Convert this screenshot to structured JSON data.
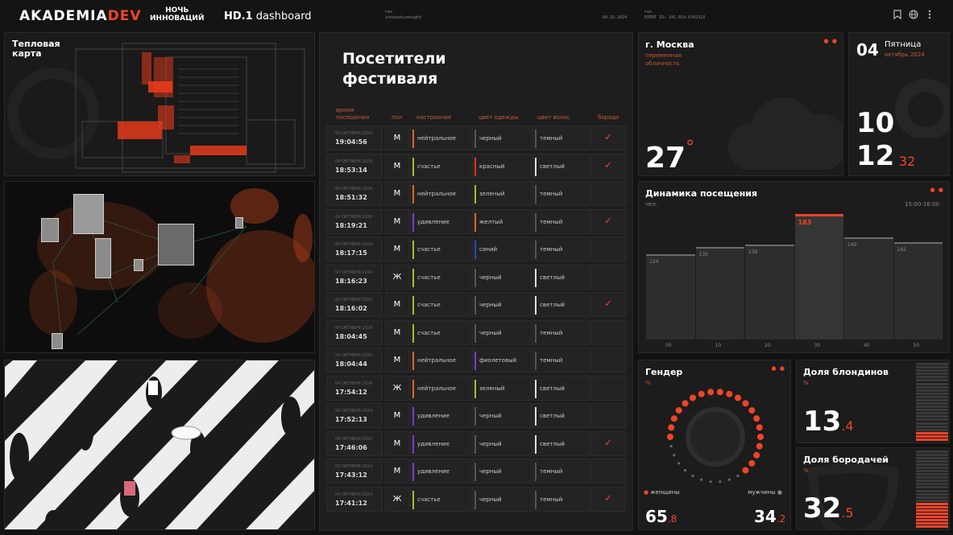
{
  "header": {
    "logo_main": "AKADEMIA",
    "logo_accent": "DEV",
    "partner_line1": "НОЧЬ",
    "partner_line2": "ИННОВАЦИЙ",
    "dashboard_strong": "HD.1",
    "dashboard_rest": " dashboard",
    "meta1_label": "гео",
    "meta1_value": "innovationnight",
    "meta2_value": "04.10.2024",
    "meta3_label": "гео",
    "meta3_value": "EVENT ID: 241.014.6f0231X",
    "icons": [
      "bookmark-icon",
      "globe-icon",
      "more-icon"
    ]
  },
  "heatmap": {
    "title_line1": "Тепловая",
    "title_line2": "карта"
  },
  "visitors": {
    "title_line1": "Посетители",
    "title_line2": "фестиваля",
    "columns": {
      "time": [
        "время",
        "посещения"
      ],
      "gender": "пол",
      "mood": "настроение",
      "clothes": "цвет одежды",
      "hair": "цвет волос",
      "beard": "бородо"
    },
    "rows": [
      {
        "stamp": "04 ОКТЯБРЯ 2024",
        "time": "19:04:56",
        "gender": "М",
        "mood": "нейтральное",
        "mood_color": "#e0662a",
        "clothes": "черный",
        "clothes_color": "#555555",
        "hair": "темный",
        "hair_color": "#555555",
        "beard": true
      },
      {
        "stamp": "04 ОКТЯБРЯ 2024",
        "time": "18:53:14",
        "gender": "М",
        "mood": "счастье",
        "mood_color": "#a8c12a",
        "clothes": "красный",
        "clothes_color": "#e0331e",
        "hair": "светлый",
        "hair_color": "#dddddd",
        "beard": true
      },
      {
        "stamp": "04 ОКТЯБРЯ 2024",
        "time": "18:51:32",
        "gender": "М",
        "mood": "нейтральное",
        "mood_color": "#e0662a",
        "clothes": "зеленый",
        "clothes_color": "#a8c12a",
        "hair": "темный",
        "hair_color": "#555555",
        "beard": false
      },
      {
        "stamp": "04 ОКТЯБРЯ 2024",
        "time": "18:19:21",
        "gender": "М",
        "mood": "удивление",
        "mood_color": "#7a3ad0",
        "clothes": "желтый",
        "clothes_color": "#e0662a",
        "hair": "темный",
        "hair_color": "#555555",
        "beard": true
      },
      {
        "stamp": "04 ОКТЯБРЯ 2024",
        "time": "18:17:15",
        "gender": "М",
        "mood": "счастье",
        "mood_color": "#a8c12a",
        "clothes": "синий",
        "clothes_color": "#2a4ac0",
        "hair": "темный",
        "hair_color": "#555555",
        "beard": false
      },
      {
        "stamp": "04 ОКТЯБРЯ 2024",
        "time": "18:16:23",
        "gender": "Ж",
        "mood": "счастье",
        "mood_color": "#a8c12a",
        "clothes": "черный",
        "clothes_color": "#555555",
        "hair": "светлый",
        "hair_color": "#dddddd",
        "beard": false
      },
      {
        "stamp": "04 ОКТЯБРЯ 2024",
        "time": "18:16:02",
        "gender": "М",
        "mood": "счастье",
        "mood_color": "#a8c12a",
        "clothes": "черный",
        "clothes_color": "#555555",
        "hair": "светлый",
        "hair_color": "#dddddd",
        "beard": true
      },
      {
        "stamp": "04 ОКТЯБРЯ 2024",
        "time": "18:04:45",
        "gender": "М",
        "mood": "счастье",
        "mood_color": "#a8c12a",
        "clothes": "черный",
        "clothes_color": "#555555",
        "hair": "темный",
        "hair_color": "#555555",
        "beard": false
      },
      {
        "stamp": "04 ОКТЯБРЯ 2024",
        "time": "18:04:44",
        "gender": "М",
        "mood": "нейтральное",
        "mood_color": "#e0662a",
        "clothes": "фиолетовый",
        "clothes_color": "#7a3ad0",
        "hair": "темный",
        "hair_color": "#555555",
        "beard": false
      },
      {
        "stamp": "04 ОКТЯБРЯ 2024",
        "time": "17:54:12",
        "gender": "Ж",
        "mood": "нейтральное",
        "mood_color": "#e0662a",
        "clothes": "зеленый",
        "clothes_color": "#a8c12a",
        "hair": "светлый",
        "hair_color": "#dddddd",
        "beard": false
      },
      {
        "stamp": "04 ОКТЯБРЯ 2024",
        "time": "17:52:13",
        "gender": "М",
        "mood": "удивление",
        "mood_color": "#7a3ad0",
        "clothes": "черный",
        "clothes_color": "#555555",
        "hair": "светлый",
        "hair_color": "#dddddd",
        "beard": false
      },
      {
        "stamp": "04 ОКТЯБРЯ 2024",
        "time": "17:46:06",
        "gender": "М",
        "mood": "удивление",
        "mood_color": "#7a3ad0",
        "clothes": "черный",
        "clothes_color": "#555555",
        "hair": "светлый",
        "hair_color": "#dddddd",
        "beard": true
      },
      {
        "stamp": "04 ОКТЯБРЯ 2024",
        "time": "17:43:12",
        "gender": "М",
        "mood": "удивление",
        "mood_color": "#7a3ad0",
        "clothes": "черный",
        "clothes_color": "#555555",
        "hair": "темный",
        "hair_color": "#555555",
        "beard": false
      },
      {
        "stamp": "04 ОКТЯБРЯ 2024",
        "time": "17:41:12",
        "gender": "Ж",
        "mood": "счастье",
        "mood_color": "#a8c12a",
        "clothes": "черный",
        "clothes_color": "#555555",
        "hair": "темный",
        "hair_color": "#555555",
        "beard": true
      }
    ]
  },
  "weather": {
    "city": "г. Москва",
    "condition_line1": "переменная",
    "condition_line2": "облачность",
    "temperature": "27",
    "unit": "°"
  },
  "date": {
    "day": "04",
    "weekday": "Пятница",
    "month_year": "октябрь 2024",
    "hours": "10",
    "minutes": "12",
    "seconds": "32"
  },
  "attendance": {
    "title": "Динамика посещения",
    "unit": "чел.",
    "range": "15:00-16:00"
  },
  "gender": {
    "title": "Гендер",
    "unit": "%",
    "women_label": "женщины",
    "men_label": "мужчины",
    "women_int": "65",
    "women_dec": ".8",
    "men_int": "34",
    "men_dec": ".2",
    "women_share": 65.8
  },
  "blondes": {
    "title": "Доля блондинов",
    "unit": "%",
    "value_int": "13",
    "value_dec": ".4",
    "share": 13.4
  },
  "bearded": {
    "title": "Доля бородачей",
    "unit": "%",
    "value_int": "32",
    "value_dec": ".5",
    "share": 32.5
  },
  "chart_data": {
    "type": "bar",
    "title": "Динамика посещения",
    "ylabel": "чел.",
    "range_label": "15:00-16:00",
    "categories": [
      "00",
      "10",
      "20",
      "30",
      "40",
      "50"
    ],
    "values": [
      124,
      135,
      139,
      183,
      149,
      142
    ],
    "highlight_index": 3,
    "accent": "#f0442a"
  },
  "colors": {
    "accent": "#f0442a",
    "background": "#121212",
    "panel": "#1c1c1c"
  }
}
